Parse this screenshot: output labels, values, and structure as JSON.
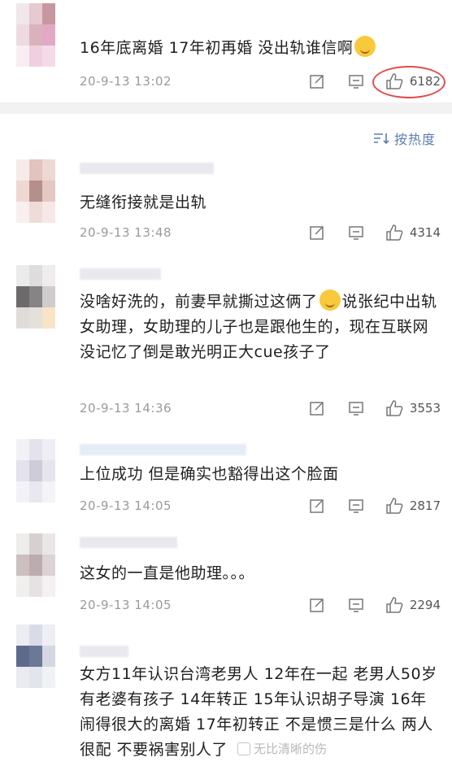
{
  "comments": [
    {
      "text": "16年底离婚 17年初再婚 没出轨谁信啊",
      "time": "20-9-13 13:02",
      "likes": "6182"
    },
    {
      "text": "无缝衔接就是出轨",
      "time": "20-9-13 13:48",
      "likes": "4314"
    },
    {
      "text_before_emoji": "没啥好洗的，前妻早就撕过这俩了",
      "text_after_emoji": "说张纪中出轨女助理，女助理的儿子也是跟他生的，现在互联网没记忆了倒是敢光明正大cue孩子了",
      "time": "20-9-13 14:36",
      "likes": "3553"
    },
    {
      "text": "上位成功 但是确实也豁得出这个脸面",
      "time": "20-9-13 14:05",
      "likes": "2817"
    },
    {
      "text": "这女的一直是他助理。。。",
      "time": "20-9-13 14:05",
      "likes": "2294"
    },
    {
      "text": "女方11年认识台湾老男人 12年在一起 老男人50岁有老婆有孩子 14年转正 15年认识胡子导演 16年闹得很大的离婚 17年初转正 不是惯三是什么 两人很配 不要祸害别人了"
    }
  ],
  "sort": {
    "label": "按热度"
  },
  "watermark": {
    "text": "无比清晰的伤"
  },
  "colors": {
    "highlight": "#e34b4b",
    "sort_link": "#5b7fb0",
    "time": "#9a9a9a"
  },
  "icons": [
    "edit-icon",
    "reply-icon",
    "like-icon",
    "sort-icon",
    "emoji-icon"
  ]
}
